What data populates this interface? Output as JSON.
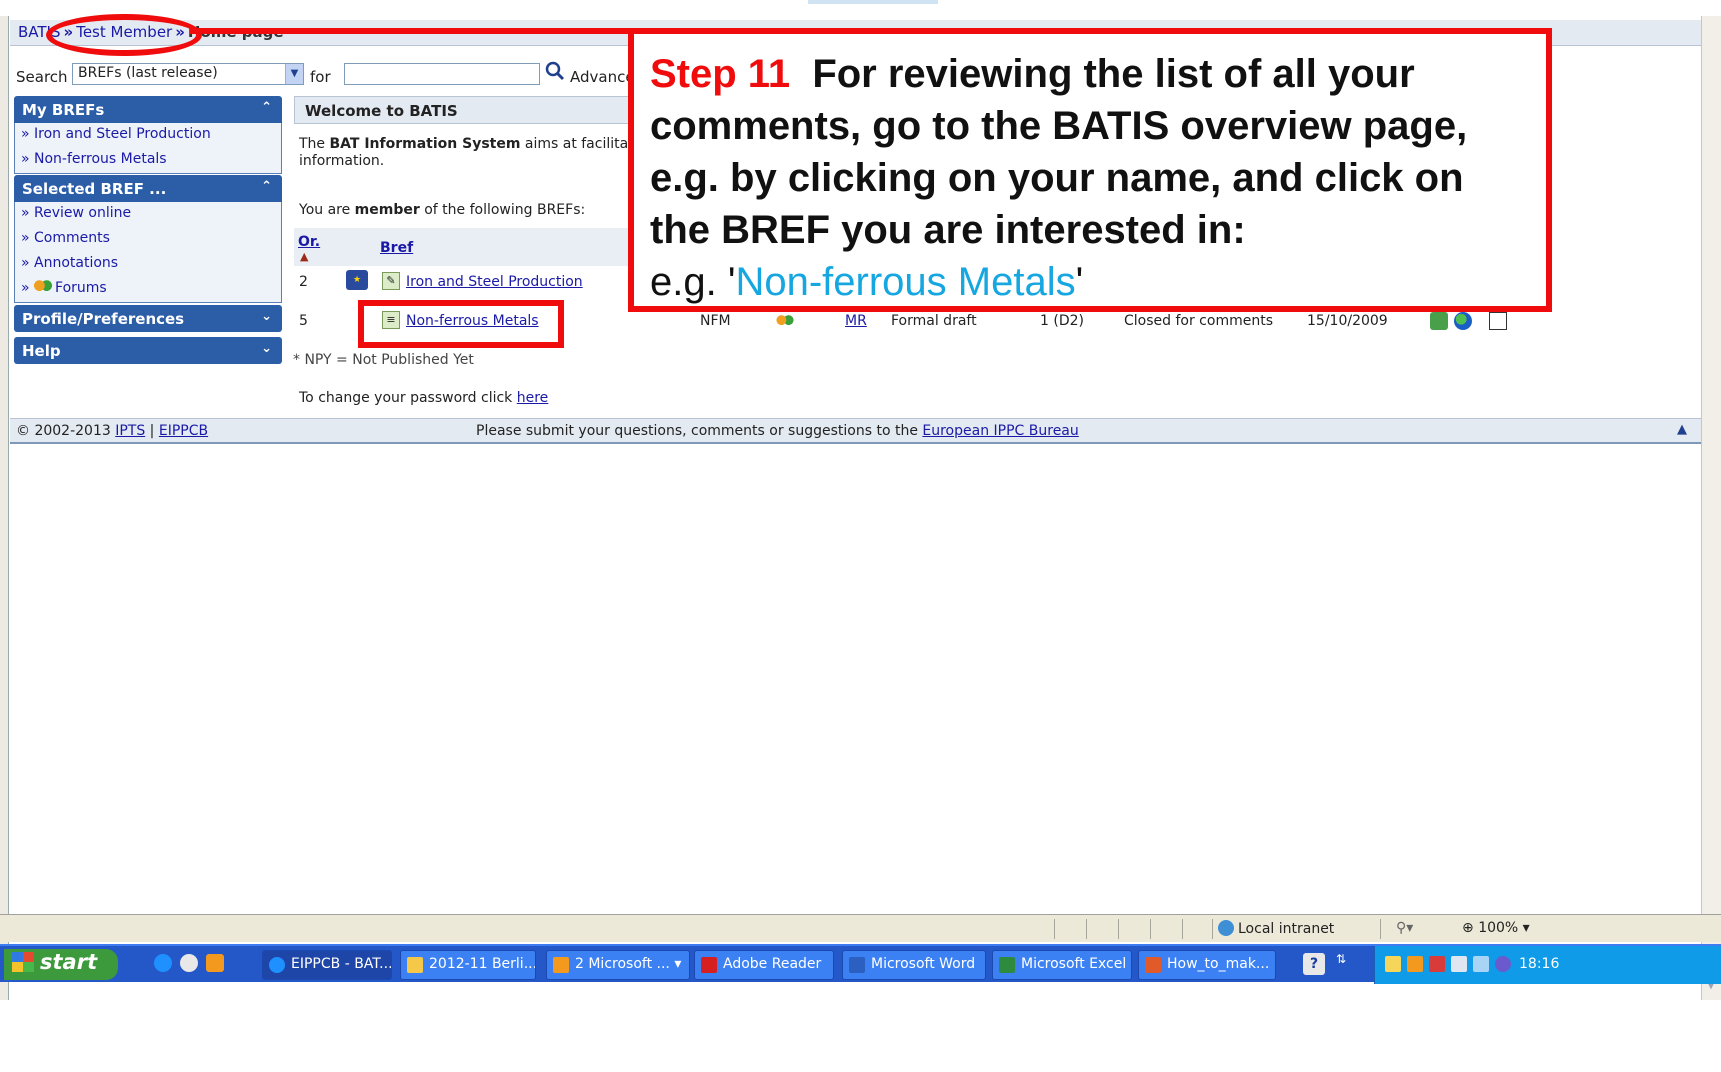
{
  "breadcrumb": {
    "root": "BATIS",
    "member": "Test Member",
    "current": "Home page"
  },
  "search": {
    "label": "Search",
    "scope_value": "BREFs (last release)",
    "for_label": "for",
    "input_value": "",
    "advanced_label": "Advance"
  },
  "sidebar": {
    "my_brefs": {
      "title": "My BREFs",
      "items": [
        {
          "label": "Iron and Steel Production"
        },
        {
          "label": "Non-ferrous Metals"
        }
      ]
    },
    "selected_bref": {
      "title": "Selected BREF ...",
      "items": [
        {
          "label": "Review online"
        },
        {
          "label": "Comments"
        },
        {
          "label": "Annotations"
        },
        {
          "label": "Forums"
        }
      ]
    },
    "profile": {
      "title": "Profile/Preferences"
    },
    "help": {
      "title": "Help"
    }
  },
  "main": {
    "welcome_title": "Welcome to BATIS",
    "intro_prefix": "The ",
    "intro_bold": "BAT Information System",
    "intro_suffix": " aims at facilita",
    "intro_line2": "information.",
    "member_prefix": "You are ",
    "member_bold": "member",
    "member_suffix": " of the following BREFs:",
    "table": {
      "col_order": "Or.",
      "col_bref": "Bref",
      "rows": [
        {
          "order": "2",
          "name": "Iron and Steel Production"
        },
        {
          "order": "5",
          "name": "Non-ferrous Metals",
          "code": "NFM",
          "link": "MR",
          "stage": "Formal draft",
          "version": "1 (D2)",
          "status": "Closed for comments",
          "date": "15/10/2009"
        }
      ]
    },
    "npy_note": "* NPY = Not Published Yet",
    "password_prefix": "To change your password click ",
    "password_link": "here"
  },
  "footer": {
    "copyright": "© 2002-2013 ",
    "ipts": "IPTS",
    "sep": " | ",
    "eippcb": "EIPPCB",
    "message": "Please submit your questions, comments or suggestions to the ",
    "bureau_link": "European IPPC Bureau"
  },
  "annotation": {
    "step": "Step 11",
    "text_bold": "For reviewing the list of all your comments, go to the BATIS overview page, e.g. by clicking on your name, and click on the BREF you are interested in:",
    "text_prefix": "e.g. '",
    "highlight": "Non-ferrous Metals",
    "text_suffix": "'"
  },
  "statusbar": {
    "zone": "Local intranet",
    "zoom": "100%"
  },
  "taskbar": {
    "start": "start",
    "tasks": [
      {
        "label": "EIPPCB - BAT..."
      },
      {
        "label": "2012-11 Berli..."
      },
      {
        "label": "2 Microsoft ..."
      },
      {
        "label": "Adobe Reader"
      },
      {
        "label": "Microsoft Word"
      },
      {
        "label": "Microsoft Excel"
      },
      {
        "label": "How_to_mak..."
      }
    ],
    "clock": "18:16"
  },
  "colors": {
    "annotation_red": "#f00c0c",
    "highlight_blue": "#16a6e0",
    "sidebar_header": "#2c5ea8",
    "link": "#1a1aa6"
  }
}
